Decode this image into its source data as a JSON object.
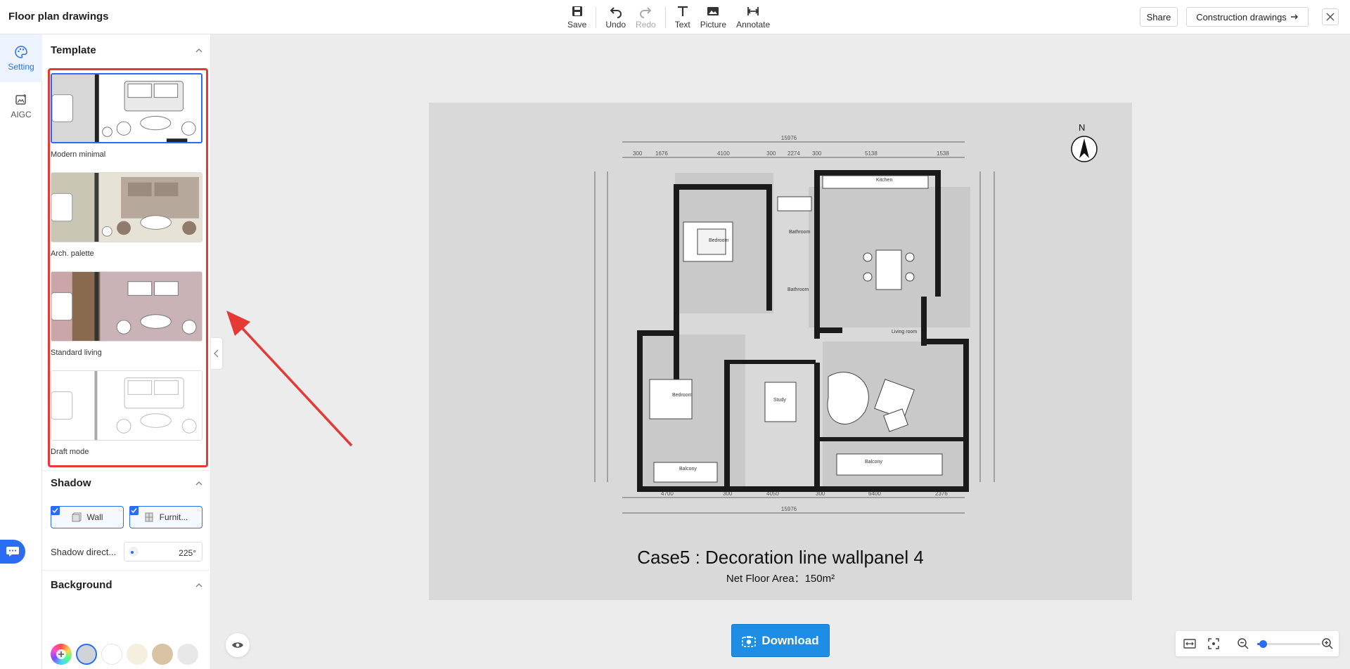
{
  "app": {
    "title": "Floor plan drawings"
  },
  "toolbar": {
    "save": "Save",
    "undo": "Undo",
    "redo": "Redo",
    "text": "Text",
    "picture": "Picture",
    "annotate": "Annotate"
  },
  "header_actions": {
    "share": "Share",
    "construction": "Construction drawings"
  },
  "rail": [
    {
      "label": "Setting",
      "icon": "palette-icon",
      "active": true
    },
    {
      "label": "AIGC",
      "icon": "image-ai-icon",
      "active": false
    }
  ],
  "template_section": {
    "title": "Template",
    "items": [
      {
        "label": "Modern minimal",
        "selected": true,
        "bg": "#ffffff",
        "left": "#d7d7d7"
      },
      {
        "label": "Arch. palette",
        "selected": false,
        "bg": "#b7a89c",
        "left": "#c9c6b4"
      },
      {
        "label": "Standard living",
        "selected": false,
        "bg": "#c9b3b6",
        "left": "#9b7d62"
      },
      {
        "label": "Draft mode",
        "selected": false,
        "bg": "#ffffff",
        "left": "#ffffff"
      }
    ]
  },
  "shadow_section": {
    "title": "Shadow",
    "wall": "Wall",
    "furniture": "Furnit...",
    "direction_label": "Shadow direct...",
    "direction_value": "225°"
  },
  "background_section": {
    "title": "Background",
    "swatches": [
      "#cfd3d8",
      "#ffffff",
      "#f4efdf",
      "#d8c3a5",
      "#e8e8e8"
    ]
  },
  "canvas": {
    "compass_label": "N",
    "title": "Case5 : Decoration line wallpanel 4",
    "subtitle": "Net Floor Area：150m²"
  },
  "download": {
    "label": "Download"
  },
  "zoom": {
    "level": 0.05
  }
}
